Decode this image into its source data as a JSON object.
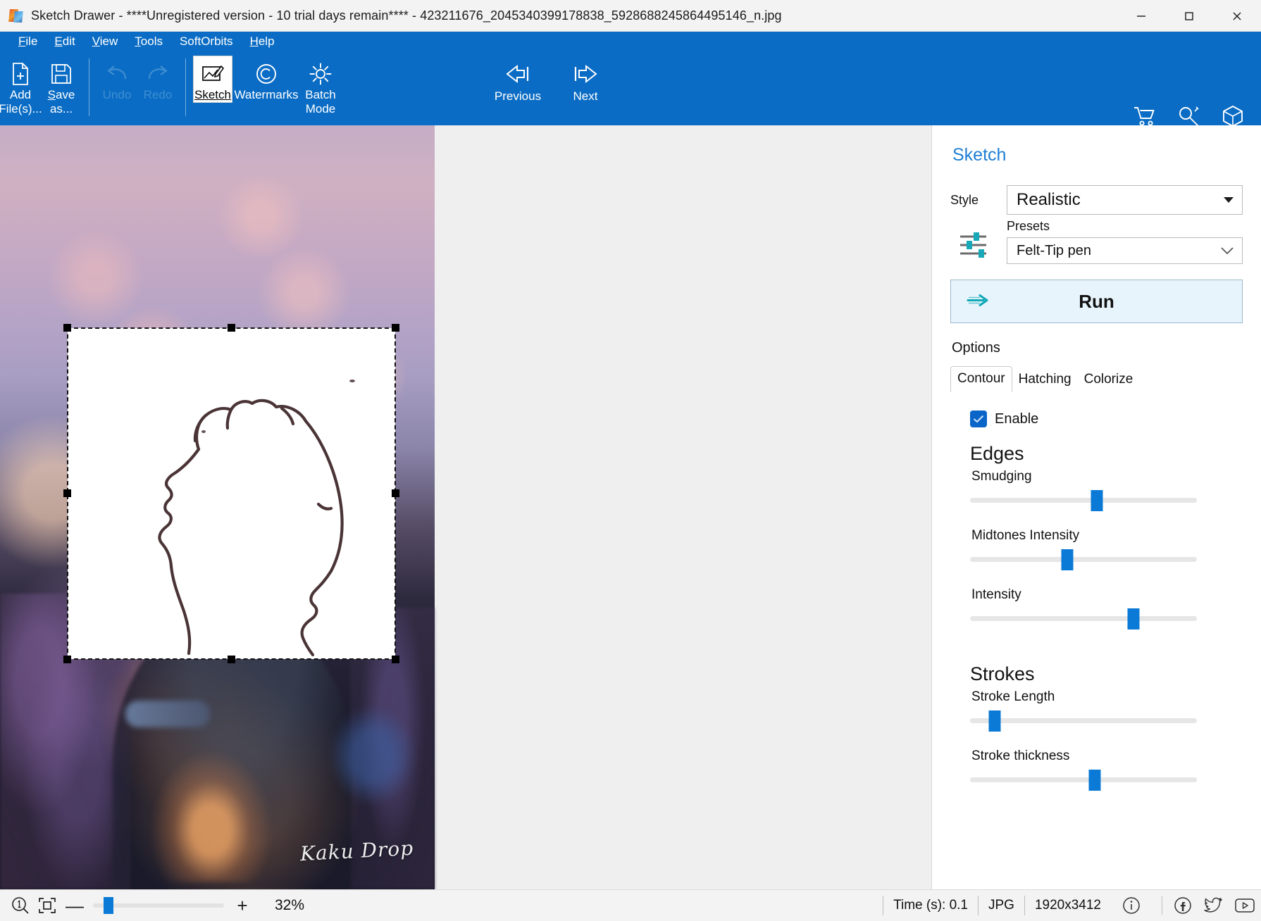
{
  "window": {
    "title": "Sketch Drawer - ****Unregistered version - 10 trial days remain**** - 423211676_2045340399178838_5928688245864495146_n.jpg",
    "app_icon": "sketch-drawer-logo",
    "minimize": "—",
    "maximize": "□",
    "close": "✕"
  },
  "menubar": {
    "items": [
      {
        "label": "File",
        "accel": "F"
      },
      {
        "label": "Edit",
        "accel": "E"
      },
      {
        "label": "View",
        "accel": "V"
      },
      {
        "label": "Tools",
        "accel": "T"
      },
      {
        "label": "SoftOrbits",
        "accel": ""
      },
      {
        "label": "Help",
        "accel": "H"
      }
    ]
  },
  "ribbon": {
    "tools": [
      {
        "name": "add-files",
        "line1": "Add",
        "line2": "File(s)...",
        "icon": "file-plus-icon",
        "enabled": true
      },
      {
        "name": "save-as",
        "line1": "Save",
        "line2": "as...",
        "icon": "floppy-disk-icon",
        "enabled": true
      },
      {
        "name": "undo",
        "line1": "Undo",
        "line2": "",
        "icon": "undo-arrow-icon",
        "enabled": false
      },
      {
        "name": "redo",
        "line1": "Redo",
        "line2": "",
        "icon": "redo-arrow-icon",
        "enabled": false
      },
      {
        "name": "sketch",
        "line1": "Sketch",
        "line2": "",
        "icon": "sketch-pencil-icon",
        "enabled": true,
        "selected": true
      },
      {
        "name": "watermarks",
        "line1": "Watermarks",
        "line2": "",
        "icon": "copyright-icon",
        "enabled": true
      },
      {
        "name": "batch-mode",
        "line1": "Batch",
        "line2": "Mode",
        "icon": "gear-icon",
        "enabled": true
      }
    ],
    "nav": [
      {
        "name": "previous",
        "label": "Previous",
        "icon": "arrow-left-bar-icon"
      },
      {
        "name": "next",
        "label": "Next",
        "icon": "arrow-right-bar-icon"
      }
    ],
    "right_icons": [
      {
        "name": "cart-icon",
        "label": "Buy"
      },
      {
        "name": "key-icon",
        "label": "Register"
      },
      {
        "name": "box-icon",
        "label": "Products"
      }
    ]
  },
  "canvas": {
    "watermark_text": "Kaku Drop",
    "selection": {
      "handles": 8,
      "style": "dashed"
    },
    "sketch_alt": "line-art profile of a face"
  },
  "panel": {
    "title": "Sketch",
    "style_label": "Style",
    "style_value": "Realistic",
    "presets_label": "Presets",
    "presets_value": "Felt-Tip pen",
    "presets_icon": "sliders-icon",
    "run_label": "Run",
    "run_icon": "run-arrow-icon",
    "options_label": "Options",
    "tabs": [
      {
        "label": "Contour",
        "active": true
      },
      {
        "label": "Hatching",
        "active": false
      },
      {
        "label": "Colorize",
        "active": false
      }
    ],
    "enable_label": "Enable",
    "enable_checked": true,
    "groups": [
      {
        "heading": "Edges",
        "sliders": [
          {
            "label": "Smudging",
            "value": 56
          },
          {
            "label": "Midtones Intensity",
            "value": 43
          },
          {
            "label": "Intensity",
            "value": 72
          }
        ]
      },
      {
        "heading": "Strokes",
        "sliders": [
          {
            "label": "Stroke Length",
            "value": 11
          },
          {
            "label": "Stroke thickness",
            "value": 55
          }
        ]
      }
    ]
  },
  "statusbar": {
    "zoom_one_to_one_icon": "magnifier-one-icon",
    "fit_icon": "fit-to-screen-icon",
    "minus": "—",
    "plus": "+",
    "zoom_value": 12,
    "zoom_percent": "32%",
    "time": "Time (s): 0.1",
    "format": "JPG",
    "dimensions": "1920x3412",
    "social": [
      {
        "name": "info-icon"
      },
      {
        "name": "facebook-icon"
      },
      {
        "name": "twitter-icon"
      },
      {
        "name": "youtube-icon"
      }
    ]
  }
}
